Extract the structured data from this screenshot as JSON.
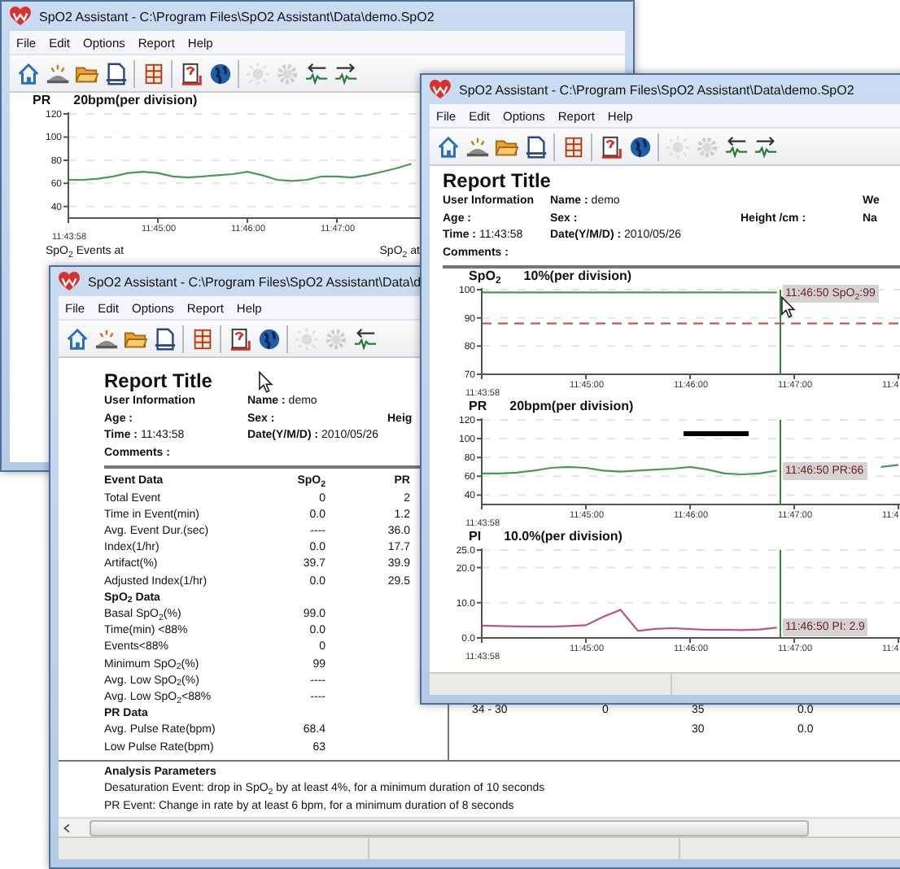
{
  "back_window": {
    "title": "SpO2 Assistant  -  C:\\Program Files\\SpO2 Assistant\\Data\\demo.SpO2",
    "menu": [
      "File",
      "Edit",
      "Options",
      "Report",
      "Help"
    ],
    "toolbar": [
      {
        "kind": "home",
        "disabled": false
      },
      {
        "kind": "dish",
        "disabled": false
      },
      {
        "kind": "folder",
        "disabled": false
      },
      {
        "kind": "document",
        "disabled": false
      },
      {
        "kind": "table",
        "disabled": false
      },
      {
        "kind": "report",
        "disabled": false
      },
      {
        "kind": "globe",
        "disabled": false
      },
      {
        "kind": "sun",
        "disabled": true
      },
      {
        "kind": "gear",
        "disabled": true
      },
      {
        "kind": "wave-left",
        "disabled": false
      },
      {
        "kind": "wave-right",
        "disabled": false
      }
    ],
    "chart": {
      "scale": "20bpm(per division)",
      "chart_data": {
        "type": "line",
        "title": "PR",
        "categories": [
          "11:43:58",
          null,
          null,
          null,
          null,
          null,
          "11:45:00",
          null,
          null,
          null,
          null,
          null,
          "11:46:00",
          null,
          null,
          null,
          null,
          null,
          "11:47:00",
          null,
          null,
          null,
          null,
          null,
          null
        ],
        "series": [
          {
            "color": "#4c9a4c",
            "values": [
              63,
              63,
              64,
              66,
              69,
              70,
              69,
              66,
              65,
              66,
              67,
              68,
              70,
              67,
              63,
              62,
              63,
              66,
              66,
              65,
              67,
              70,
              73,
              77,
              null
            ]
          }
        ],
        "ylim": [
          30,
          120
        ],
        "yticks": [
          40,
          60,
          80,
          100,
          120
        ],
        "grid": true
      }
    },
    "events_captions": [
      "SpO$_{2}$ Events at",
      "SpO$_{2}$ at"
    ]
  },
  "report_window": {
    "title": "SpO2 Assistant  -  C:\\Program Files\\SpO2 Assistant\\Data\\d",
    "menu": [
      "File",
      "Edit",
      "Options",
      "Report",
      "Help"
    ],
    "toolbar": [
      {
        "kind": "home",
        "disabled": false
      },
      {
        "kind": "dish",
        "disabled": false
      },
      {
        "kind": "folder",
        "disabled": false
      },
      {
        "kind": "document",
        "disabled": false
      },
      {
        "kind": "table",
        "disabled": false
      },
      {
        "kind": "report",
        "disabled": false
      },
      {
        "kind": "globe",
        "disabled": false
      },
      {
        "kind": "sun",
        "disabled": true
      },
      {
        "kind": "gear",
        "disabled": true
      },
      {
        "kind": "wave-left",
        "disabled": false
      }
    ],
    "report_title": "Report Title",
    "user_info": [
      {
        "left": {
          "label": "User Information"
        },
        "mid": {
          "label": "Name :",
          "value": "demo"
        }
      },
      {
        "left": {
          "label": "Age :"
        },
        "mid": {
          "label": "Sex :"
        },
        "right": {
          "label": "Heig"
        }
      },
      {
        "left": {
          "label": "Time :",
          "value": "11:43:58"
        },
        "mid": {
          "label": "Date(Y/M/D) :",
          "value": "2010/05/26"
        }
      },
      {
        "left": {
          "label": "Comments :"
        }
      }
    ],
    "sections": [
      {
        "columns": [
          "Event Data",
          "SpO$_{2}$",
          "PR"
        ],
        "rows": [
          [
            "Total Event",
            "0",
            "2"
          ],
          [
            "Time in Event(min)",
            "0.0",
            "1.2"
          ],
          [
            "Avg. Event Dur.(sec)",
            "----",
            "36.0"
          ],
          [
            "Index(1/hr)",
            "0.0",
            "17.7"
          ],
          [
            "Artifact(%)",
            "39.7",
            "39.9"
          ],
          [
            "Adjusted Index(1/hr)",
            "0.0",
            "29.5"
          ]
        ]
      },
      {
        "heading": "SpO$_{2}$ Data",
        "rows": [
          [
            "Basal SpO$_{2}$(%)",
            "99.0"
          ],
          [
            "Time(min) <88%",
            "0.0"
          ],
          [
            "Events<88%",
            "0"
          ],
          [
            "Minimum SpO$_{2}$(%)",
            "99"
          ],
          [
            "Avg. Low SpO$_{2}$(%)",
            "----"
          ],
          [
            "Avg. Low SpO$_{2}$<88%",
            "----"
          ]
        ]
      },
      {
        "heading": "PR Data",
        "rows": [
          [
            "Avg. Pulse Rate(bpm)",
            "68.4"
          ],
          [
            "Low Pulse Rate(bpm)",
            "63"
          ]
        ]
      }
    ],
    "side_rows": [
      {
        "column_1": "34 - 30",
        "column_2": "0",
        "column_3": "35",
        "column_4": "0.0"
      },
      {
        "column_3": "30",
        "column_4": "0.0"
      }
    ],
    "analysis": {
      "heading": "Analysis Parameters",
      "lines": [
        "Desaturation Event: drop in SpO$_{2}$ by at least 4%,  for a minimum duration of 10 seconds",
        "PR Event: Change in rate by at least 6 bpm, for a minimum duration of 8 seconds"
      ]
    }
  },
  "front_window": {
    "title": "SpO2 Assistant  -  C:\\Program Files\\SpO2 Assistant\\Data\\demo.SpO2",
    "menu": [
      "File",
      "Edit",
      "Options",
      "Report",
      "Help"
    ],
    "toolbar": [
      {
        "kind": "home",
        "disabled": false
      },
      {
        "kind": "dish",
        "disabled": false
      },
      {
        "kind": "folder",
        "disabled": false
      },
      {
        "kind": "document",
        "disabled": false
      },
      {
        "kind": "table",
        "disabled": false
      },
      {
        "kind": "report",
        "disabled": false
      },
      {
        "kind": "globe",
        "disabled": false
      },
      {
        "kind": "sun",
        "disabled": true
      },
      {
        "kind": "gear",
        "disabled": true
      },
      {
        "kind": "wave-left",
        "disabled": false
      },
      {
        "kind": "wave-right",
        "disabled": false
      }
    ],
    "report_title": "Report Title",
    "user_info": [
      {
        "left": {
          "label": "User Information"
        },
        "mid": {
          "label": "Name :",
          "value": "demo"
        },
        "far": {
          "label": "We"
        }
      },
      {
        "left": {
          "label": "Age :"
        },
        "mid": {
          "label": "Sex :"
        },
        "right": {
          "label": "Height /cm :"
        },
        "far": {
          "label": "Na"
        }
      },
      {
        "left": {
          "label": "Time :",
          "value": "11:43:58"
        },
        "mid": {
          "label": "Date(Y/M/D) :",
          "value": "2010/05/26"
        }
      },
      {
        "left": {
          "label": "Comments :"
        }
      }
    ],
    "charts": [
      {
        "scale": "10%(per division)",
        "cursor": {
          "level": 0.717,
          "readout": "11:46:50 SpO$_{2}$:99"
        },
        "chart_data": {
          "type": "line",
          "title": "SpO$_{2}$",
          "categories": [
            "11:43:58",
            null,
            null,
            null,
            null,
            null,
            "11:45:00",
            null,
            null,
            null,
            null,
            null,
            "11:46:00",
            null,
            null,
            null,
            null,
            null,
            "11:47:00",
            null,
            null,
            null,
            null,
            null,
            "11:4"
          ],
          "series": [
            {
              "line_style": "solid",
              "color": "#4c9a4c",
              "values": [
                99,
                99,
                99,
                99,
                99,
                99,
                99,
                99,
                99,
                99,
                99,
                99,
                99,
                99,
                99,
                99,
                99,
                99,
                null,
                null,
                null,
                null,
                null,
                null,
                null
              ]
            },
            {
              "line_style": "dashed",
              "color": "#d04040",
              "values": [
                88,
                88,
                88,
                88,
                88,
                88,
                88,
                88,
                88,
                88,
                88,
                88,
                88,
                88,
                88,
                88,
                88,
                88,
                88,
                88,
                88,
                88,
                88,
                88,
                88
              ]
            }
          ],
          "ylim": [
            70,
            100
          ],
          "yticks": [
            70,
            80,
            90,
            100
          ],
          "grid": true
        }
      },
      {
        "scale": "20bpm(per division)",
        "cursor": {
          "level": 0.717,
          "readout": "11:46:50 PR:66"
        },
        "chart_data": {
          "type": "line",
          "title": "PR",
          "categories": [
            "11:43:58",
            null,
            null,
            null,
            null,
            null,
            "11:45:00",
            null,
            null,
            null,
            null,
            null,
            "11:46:00",
            null,
            null,
            null,
            null,
            null,
            "11:47:00",
            null,
            null,
            null,
            null,
            null,
            "11:4"
          ],
          "series": [
            {
              "color": "#4c9a4c",
              "values": [
                63,
                63,
                64,
                66,
                69,
                70,
                69,
                66,
                65,
                66,
                67,
                68,
                70,
                67,
                63,
                62,
                63,
                66,
                null,
                null,
                null,
                null,
                null,
                70,
                72
              ]
            }
          ],
          "ylim": [
            30,
            120
          ],
          "yticks": [
            40,
            60,
            80,
            100,
            120
          ],
          "grid": true
        }
      },
      {
        "scale": "10.0%(per division)",
        "cursor": {
          "level": 0.717,
          "readout": "11:46:50 PI: 2.9"
        },
        "chart_data": {
          "type": "line",
          "title": "PI",
          "categories": [
            "11:43:58",
            null,
            null,
            null,
            null,
            null,
            "11:45:00",
            null,
            null,
            null,
            null,
            null,
            "11:46:00",
            null,
            null,
            null,
            null,
            null,
            "11:47:00",
            null,
            null,
            null,
            null,
            null,
            "11:4"
          ],
          "series": [
            {
              "color": "#c0508a",
              "values": [
                3.5,
                3.4,
                3.3,
                3.2,
                3.2,
                3.4,
                3.6,
                6.0,
                8.0,
                2.0,
                2.6,
                2.8,
                2.5,
                2.3,
                2.3,
                2.2,
                2.4,
                2.9,
                null,
                null,
                null,
                null,
                null,
                null,
                null
              ]
            }
          ],
          "ylim": [
            0,
            25
          ],
          "yticks": [
            {
              "value": 0,
              "label": "0.0"
            },
            {
              "value": 10,
              "label": "10.0"
            },
            {
              "value": 20,
              "label": "20.0"
            },
            {
              "value": 25,
              "label": "25.0"
            }
          ],
          "grid": true
        }
      }
    ]
  }
}
